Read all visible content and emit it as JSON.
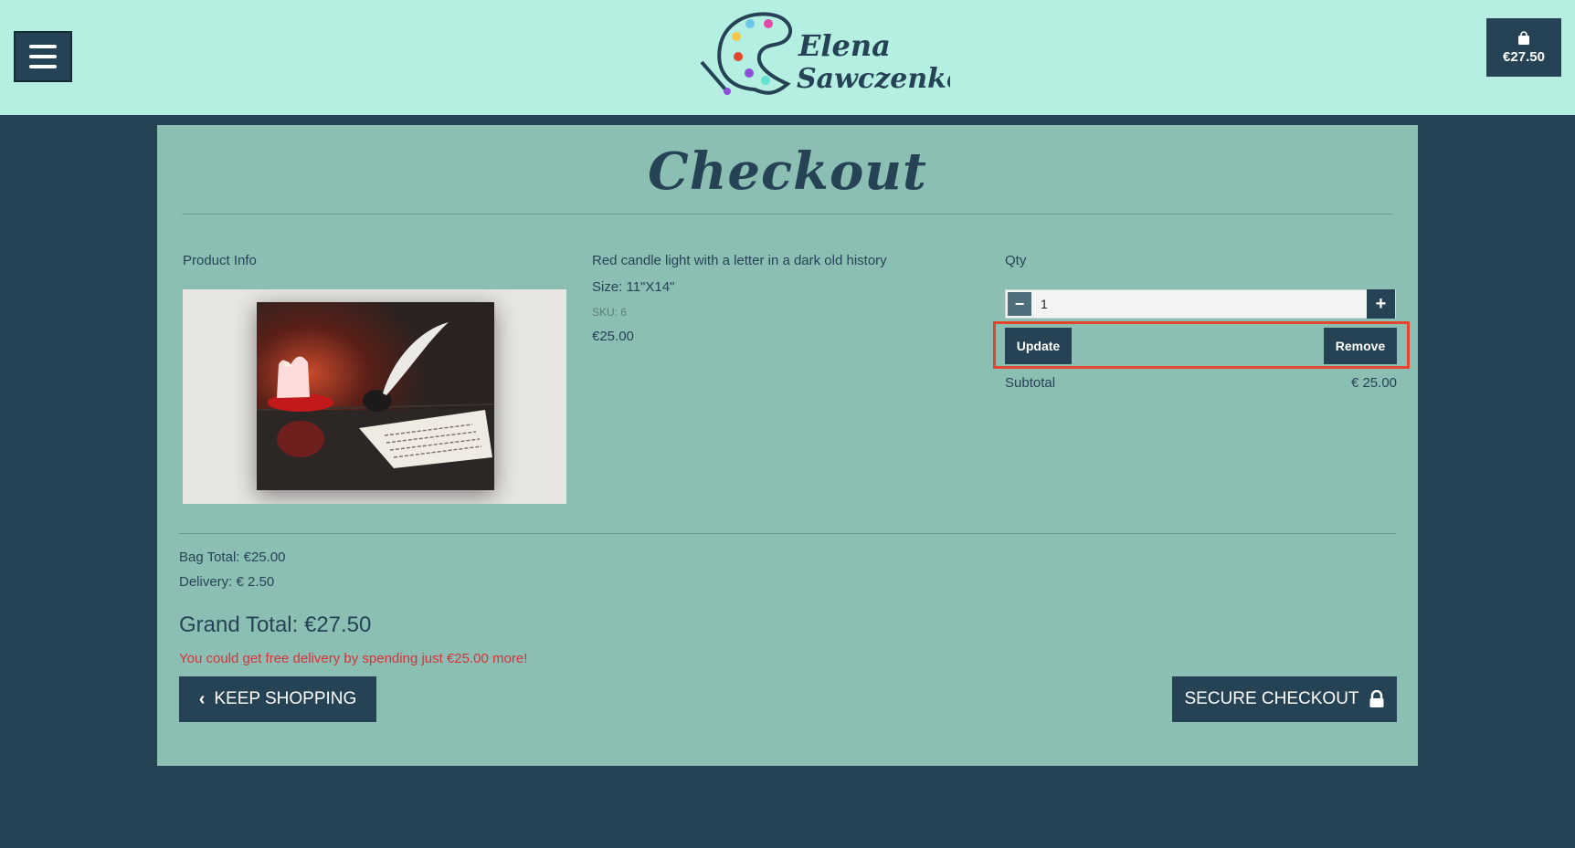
{
  "header": {
    "menu_icon": "hamburger-menu-icon",
    "logo": {
      "line1": "Elena",
      "line2": "Sawczenko"
    },
    "cart": {
      "icon": "shopping-bag-icon",
      "amount": "€27.50"
    }
  },
  "page": {
    "title": "Checkout"
  },
  "columns": {
    "product_info": "Product Info",
    "qty": "Qty"
  },
  "product": {
    "name": "Red candle light with a letter in a dark old history",
    "size": "Size: 11\"X14\"",
    "sku": "SKU: 6",
    "price": "€25.00",
    "quantity": "1",
    "decrement_label": "−",
    "increment_label": "+",
    "update_label": "Update",
    "remove_label": "Remove",
    "subtotal_label": "Subtotal",
    "subtotal_value": "€ 25.00"
  },
  "totals": {
    "bag_total": "Bag Total: €25.00",
    "delivery": "Delivery: € 2.50",
    "grand_total": "Grand Total: €27.50",
    "free_delivery_note": "You could get free delivery by spending just €25.00 more!"
  },
  "actions": {
    "keep_shopping": "KEEP SHOPPING",
    "secure_checkout": "SECURE CHECKOUT"
  },
  "colors": {
    "header_bg": "#b4efe1",
    "page_bg": "#264356",
    "card_bg": "#8bbfb3",
    "accent_dark": "#264356",
    "alert_red": "#d8323a",
    "highlight_border": "#e5452a"
  }
}
